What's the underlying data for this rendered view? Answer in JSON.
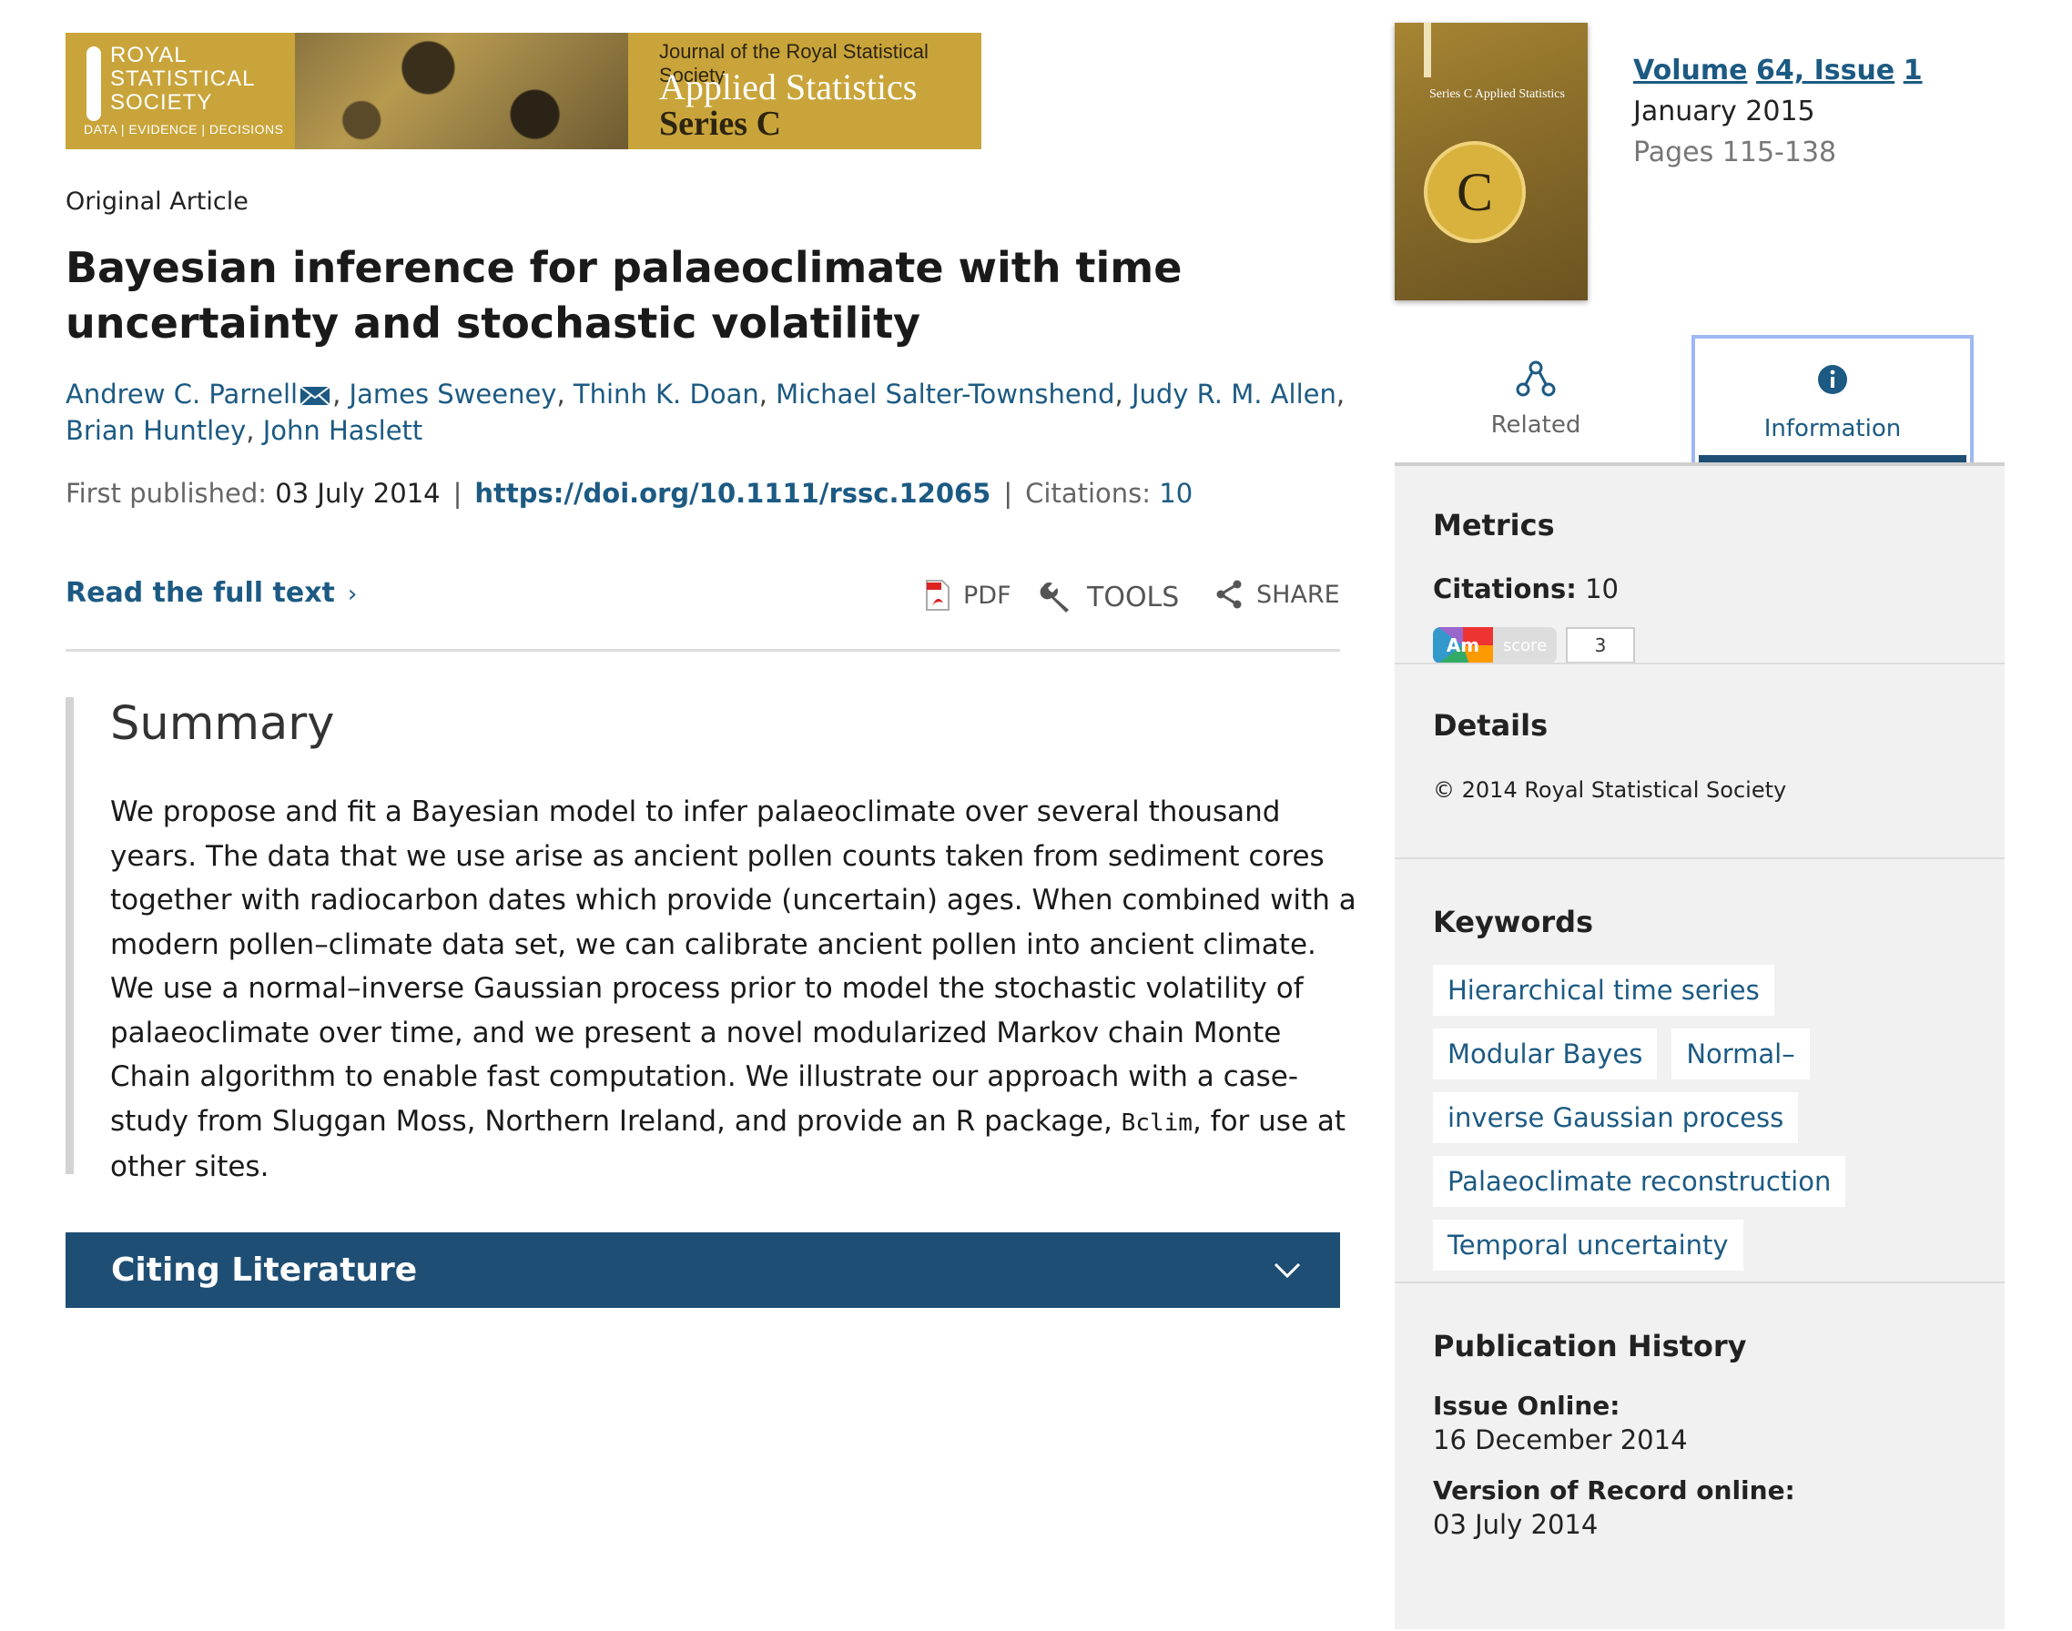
{
  "banner": {
    "society_lines": [
      "ROYAL",
      "STATISTICAL",
      "SOCIETY"
    ],
    "society_tagline": "DATA | EVIDENCE | DECISIONS",
    "journal_name": "Journal of the Royal Statistical Society",
    "journal_title": "Applied Statistics",
    "journal_series": "Series C"
  },
  "article": {
    "type": "Original Article",
    "title": "Bayesian inference for palaeoclimate with time uncertainty and stochastic volatility",
    "authors": [
      "Andrew C. Parnell",
      "James Sweeney",
      "Thinh K. Doan",
      "Michael Salter-Townshend",
      "Judy R. M. Allen",
      "Brian Huntley",
      "John Haslett"
    ],
    "first_published_label": "First published:",
    "first_published_date": "03 July 2014",
    "doi": "https://doi.org/10.1111/rssc.12065",
    "citations_label": "Citations:",
    "citations_count": "10"
  },
  "actions": {
    "read_full_text": "Read the full text",
    "pdf": "PDF",
    "tools": "TOOLS",
    "share": "SHARE"
  },
  "summary": {
    "heading": "Summary",
    "text_before_code": "We propose and fit a Bayesian model to infer palaeoclimate over several thousand years. The data that we use arise as ancient pollen counts taken from sediment cores together with radiocarbon dates which provide (uncertain) ages. When combined with a modern pollen–climate data set, we can calibrate ancient pollen into ancient climate. We use a normal–inverse Gaussian process prior to model the stochastic volatility of palaeoclimate over time, and we present a novel modularized Markov chain Monte Chain algorithm to enable fast computation. We illustrate our approach with a case-study from Sluggan Moss, Northern Ireland, and provide an R package, ",
    "code": "Bclim",
    "text_after_code": ", for use at other sites."
  },
  "citing": {
    "label": "Citing Literature"
  },
  "cover": {
    "series_text": "Series C Applied Statistics",
    "badge_letter": "C"
  },
  "issue": {
    "volume_label": "Volume",
    "volume_number": "64, Issue",
    "issue_number": "1",
    "date": "January 2015",
    "pages": "Pages 115-138"
  },
  "tabs": {
    "related": "Related",
    "information": "Information"
  },
  "sidebar": {
    "metrics": {
      "heading": "Metrics",
      "citations_label": "Citations:",
      "citations_value": "10",
      "altmetric_am": "Am",
      "altmetric_score_label": "score",
      "altmetric_score": "3"
    },
    "details": {
      "heading": "Details",
      "copyright": "© 2014 Royal Statistical Society"
    },
    "keywords": {
      "heading": "Keywords",
      "items": [
        "Hierarchical time series",
        "Modular Bayes",
        "Normal–",
        "inverse Gaussian process",
        "Palaeoclimate reconstruction",
        "Temporal uncertainty"
      ]
    },
    "history": {
      "heading": "Publication History",
      "issue_online_label": "Issue Online:",
      "issue_online_date": "16 December 2014",
      "vor_label": "Version of Record online:",
      "vor_date": "03 July 2014"
    }
  },
  "colors": {
    "link": "#1c5a83",
    "citing_bar": "#1f4e74",
    "banner_gold": "#c9a43a",
    "sidebar_bg": "#f1f1f1",
    "tab_focus": "#9db8f3"
  },
  "icons": [
    "mail-icon",
    "pdf-icon",
    "wrench-icon",
    "share-icon",
    "related-icon",
    "info-icon",
    "chevron-right-icon",
    "chevron-down-icon"
  ]
}
